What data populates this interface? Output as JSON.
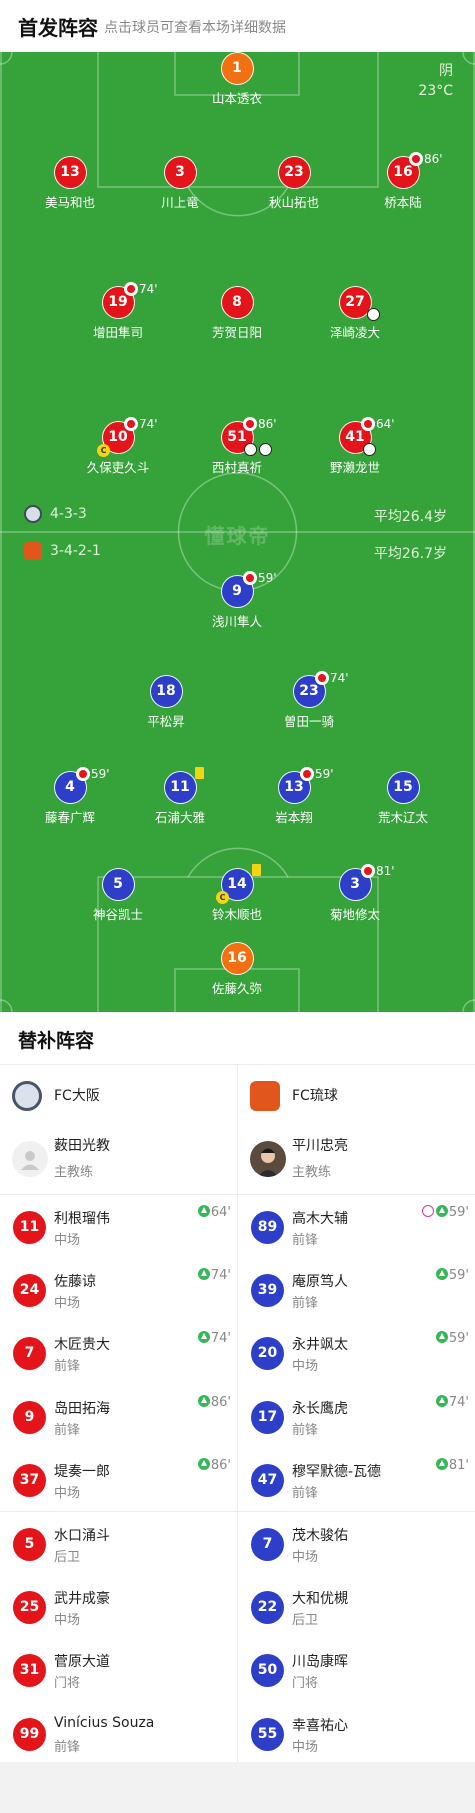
{
  "header": {
    "title": "首发阵容",
    "hint": "点击球员可查看本场详细数据"
  },
  "weather": {
    "condition": "阴",
    "temperature": "23°C"
  },
  "watermark": "懂球帝",
  "colors": {
    "pitch": "#36a33a",
    "home": "#e4141b",
    "away": "#2d3fc8",
    "keeper": "#f26f12"
  },
  "home": {
    "formation": "4-3-3",
    "avg_age": "平均26.4岁",
    "players": [
      {
        "num": "1",
        "name": "山本透衣",
        "minute": ""
      },
      {
        "num": "13",
        "name": "美马和也",
        "minute": ""
      },
      {
        "num": "3",
        "name": "川上竜",
        "minute": ""
      },
      {
        "num": "23",
        "name": "秋山拓也",
        "minute": ""
      },
      {
        "num": "16",
        "name": "桥本陆",
        "minute": "86'"
      },
      {
        "num": "19",
        "name": "增田隼司",
        "minute": "74'"
      },
      {
        "num": "8",
        "name": "芳贺日阳",
        "minute": ""
      },
      {
        "num": "27",
        "name": "泽崎凌大",
        "minute": ""
      },
      {
        "num": "10",
        "name": "久保吏久斗",
        "minute": "74'"
      },
      {
        "num": "51",
        "name": "西村真祈",
        "minute": "86'"
      },
      {
        "num": "41",
        "name": "野濑龙世",
        "minute": "64'"
      }
    ]
  },
  "away": {
    "formation": "3-4-2-1",
    "avg_age": "平均26.7岁",
    "players": [
      {
        "num": "9",
        "name": "浅川隼人",
        "minute": "59'"
      },
      {
        "num": "18",
        "name": "平松昇",
        "minute": ""
      },
      {
        "num": "23",
        "name": "曽田一骑",
        "minute": "74'"
      },
      {
        "num": "4",
        "name": "藤春广辉",
        "minute": "59'"
      },
      {
        "num": "11",
        "name": "石浦大雅",
        "minute": ""
      },
      {
        "num": "13",
        "name": "岩本翔",
        "minute": "59'"
      },
      {
        "num": "15",
        "name": "荒木辽太",
        "minute": ""
      },
      {
        "num": "5",
        "name": "神谷凯士",
        "minute": ""
      },
      {
        "num": "14",
        "name": "铃木顺也",
        "minute": ""
      },
      {
        "num": "3",
        "name": "菊地修太",
        "minute": "81'"
      },
      {
        "num": "16",
        "name": "佐藤久弥",
        "minute": ""
      }
    ]
  },
  "subs": {
    "title": "替补阵容",
    "home": {
      "team": "FC大阪",
      "coach": {
        "name": "薮田光教",
        "role": "主教练"
      },
      "players": [
        {
          "num": "11",
          "name": "利根瑠伟",
          "pos": "中场",
          "event": "64'"
        },
        {
          "num": "24",
          "name": "佐藤谅",
          "pos": "中场",
          "event": "74'"
        },
        {
          "num": "7",
          "name": "木匠贵大",
          "pos": "前锋",
          "event": "74'"
        },
        {
          "num": "9",
          "name": "岛田拓海",
          "pos": "前锋",
          "event": "86'"
        },
        {
          "num": "37",
          "name": "堤奏一郎",
          "pos": "中场",
          "event": "86'"
        },
        {
          "num": "5",
          "name": "水口涌斗",
          "pos": "后卫",
          "event": ""
        },
        {
          "num": "25",
          "name": "武井成豪",
          "pos": "中场",
          "event": ""
        },
        {
          "num": "31",
          "name": "菅原大道",
          "pos": "门将",
          "event": ""
        },
        {
          "num": "99",
          "name": "Vinícius Souza",
          "pos": "前锋",
          "event": ""
        }
      ]
    },
    "away": {
      "team": "FC琉球",
      "coach": {
        "name": "平川忠亮",
        "role": "主教练"
      },
      "players": [
        {
          "num": "89",
          "name": "高木大辅",
          "pos": "前锋",
          "event": "59'"
        },
        {
          "num": "39",
          "name": "庵原笃人",
          "pos": "前锋",
          "event": "59'"
        },
        {
          "num": "20",
          "name": "永井飒太",
          "pos": "中场",
          "event": "59'"
        },
        {
          "num": "17",
          "name": "永长鹰虎",
          "pos": "前锋",
          "event": "74'"
        },
        {
          "num": "47",
          "name": "穆罕默德-瓦德",
          "pos": "前锋",
          "event": "81'"
        },
        {
          "num": "7",
          "name": "茂木骏佑",
          "pos": "中场",
          "event": ""
        },
        {
          "num": "22",
          "name": "大和优槻",
          "pos": "后卫",
          "event": ""
        },
        {
          "num": "50",
          "name": "川岛康晖",
          "pos": "门将",
          "event": ""
        },
        {
          "num": "55",
          "name": "幸喜祐心",
          "pos": "中场",
          "event": ""
        }
      ]
    }
  }
}
